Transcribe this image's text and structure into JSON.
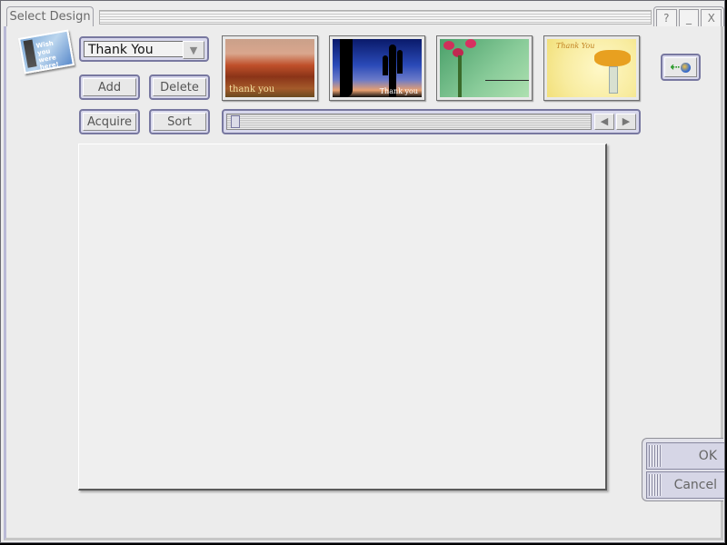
{
  "window": {
    "title": "Select Design",
    "controls": {
      "help": "?",
      "minimize": "_",
      "close": "X"
    }
  },
  "logo": {
    "text": "Wish you were here!",
    "icon": "postcard-logo-icon"
  },
  "category_combo": {
    "value": "Thank You",
    "dropdown_icon": "triangle-down-icon"
  },
  "buttons": {
    "add": "Add",
    "delete": "Delete",
    "acquire": "Acquire",
    "sort": "Sort",
    "ok": "OK",
    "cancel": "Cancel"
  },
  "thumbnails": [
    {
      "name": "red-landscape",
      "caption": "thank you"
    },
    {
      "name": "cactus-sunset",
      "caption": "Thank you"
    },
    {
      "name": "pink-tulips",
      "caption": ""
    },
    {
      "name": "yellow-tulips",
      "caption": "Thank You"
    }
  ],
  "scroller": {
    "position": 0,
    "left_icon": "◀",
    "right_icon": "▶"
  },
  "globe_button": {
    "icon": "back-to-web-icon"
  }
}
